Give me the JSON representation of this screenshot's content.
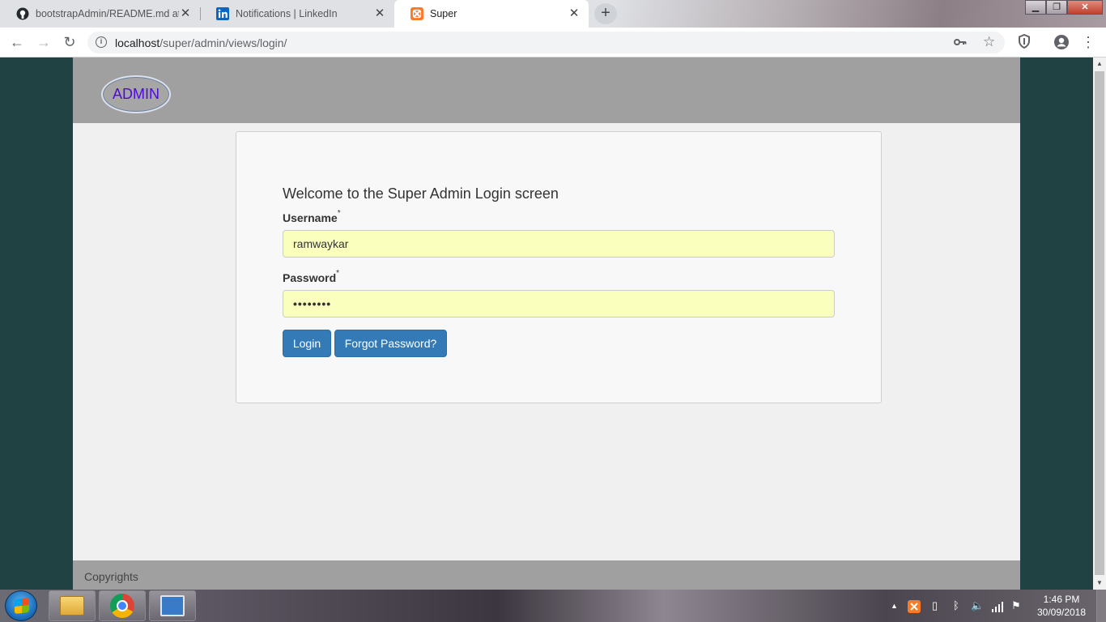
{
  "browser": {
    "tabs": [
      {
        "title": "bootstrapAdmin/README.md at",
        "icon": "github-icon"
      },
      {
        "title": "Notifications | LinkedIn",
        "icon": "linkedin-icon"
      },
      {
        "title": "Super",
        "icon": "xampp-icon",
        "active": true
      }
    ],
    "new_tab_symbol": "+",
    "url_host": "localhost",
    "url_path": "/super/admin/views/login/"
  },
  "page": {
    "logo_text": "ADMIN",
    "welcome": "Welcome to the Super Admin Login screen",
    "username_label": "Username",
    "password_label": "Password",
    "required_mark": "*",
    "username_value": "ramwaykar",
    "password_mask": "••••••••",
    "login_button": "Login",
    "forgot_button": "Forgot Password?",
    "footer_text": "Copyrights"
  },
  "taskbar": {
    "time": "1:46 PM",
    "date": "30/09/2018"
  },
  "colors": {
    "page_bg": "#214242",
    "header_bg": "#a0a0a0",
    "button_primary": "#337ab7",
    "autofill_bg": "#faffbd",
    "logo_text": "#4d0bd6"
  }
}
